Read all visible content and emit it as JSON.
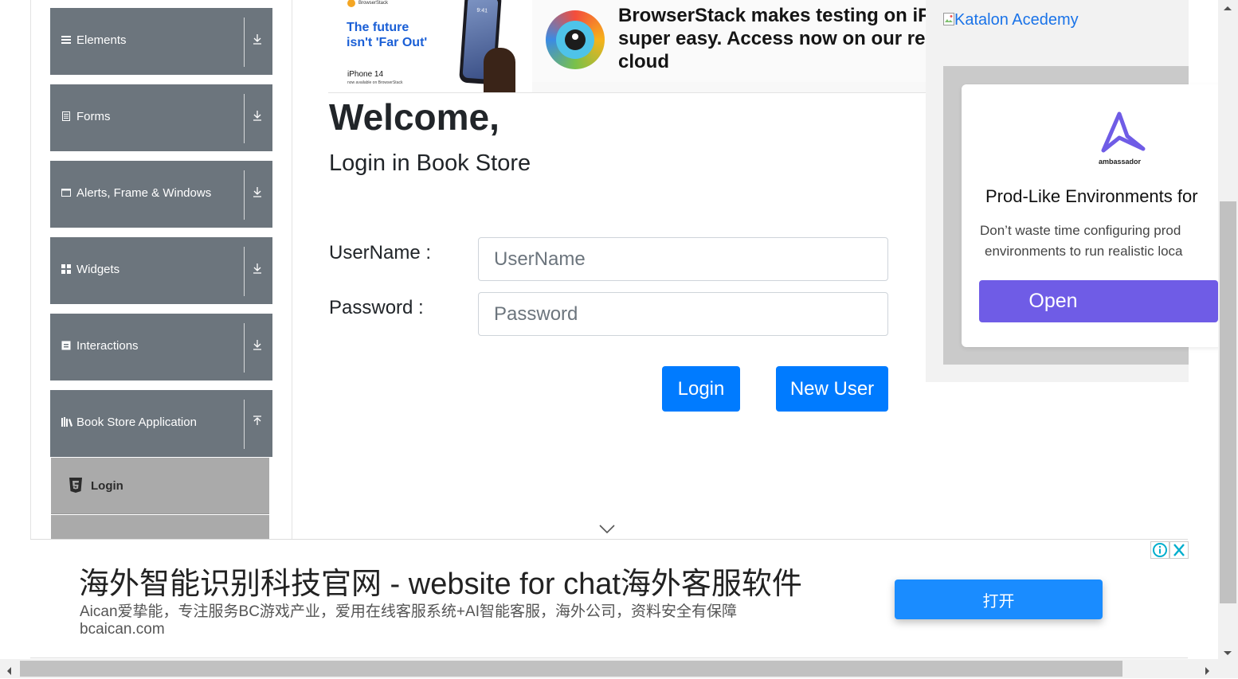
{
  "sidebar": {
    "groups": [
      {
        "label": "Elements",
        "icon": "menu-icon"
      },
      {
        "label": "Forms",
        "icon": "form-icon"
      },
      {
        "label": "Alerts, Frame & Windows",
        "icon": "window-icon"
      },
      {
        "label": "Widgets",
        "icon": "grid-icon"
      },
      {
        "label": "Interactions",
        "icon": "interactions-icon"
      },
      {
        "label": "Book Store Application",
        "icon": "books-icon"
      }
    ],
    "sub_items": [
      {
        "label": "Login",
        "icon": "html5-icon"
      }
    ]
  },
  "top_ad": {
    "brand": "BrowserStack",
    "tagline_1": "The future",
    "tagline_2": "isn't 'Far Out'",
    "device": "iPhone 14",
    "device_note": "now available on BrowserStack",
    "phone_time": "9:41",
    "headline_1": "BrowserStack makes testing on iPh",
    "headline_2": "super easy. Access now on our real",
    "headline_3": "cloud"
  },
  "main": {
    "title": "Welcome,",
    "subtitle": "Login in Book Store",
    "username_label": "UserName :",
    "username_placeholder": "UserName",
    "password_label": "Password :",
    "password_placeholder": "Password",
    "login_button": "Login",
    "new_user_button": "New User"
  },
  "right_ad": {
    "image_alt": "Katalon Acedemy",
    "logo_text": "ambassador",
    "heading": "Prod-Like Environments for",
    "body_1": "Don’t waste time configuring prod",
    "body_2": "environments to run realistic loca",
    "cta": "Open"
  },
  "bottom_ad": {
    "headline": "海外智能识别科技官网 - website for chat海外客服软件",
    "description": "Aican爱挚能，专注服务BC游戏产业，爱用在线客服系统+AI智能客服，海外公司，资料安全有保障",
    "domain": "bcaican.com",
    "cta": "打开"
  },
  "colors": {
    "sidebar_group": "#6c757d",
    "sidebar_sub": "#aaaaaa",
    "primary": "#007bff",
    "ambassador_purple": "#6f5ce6"
  }
}
